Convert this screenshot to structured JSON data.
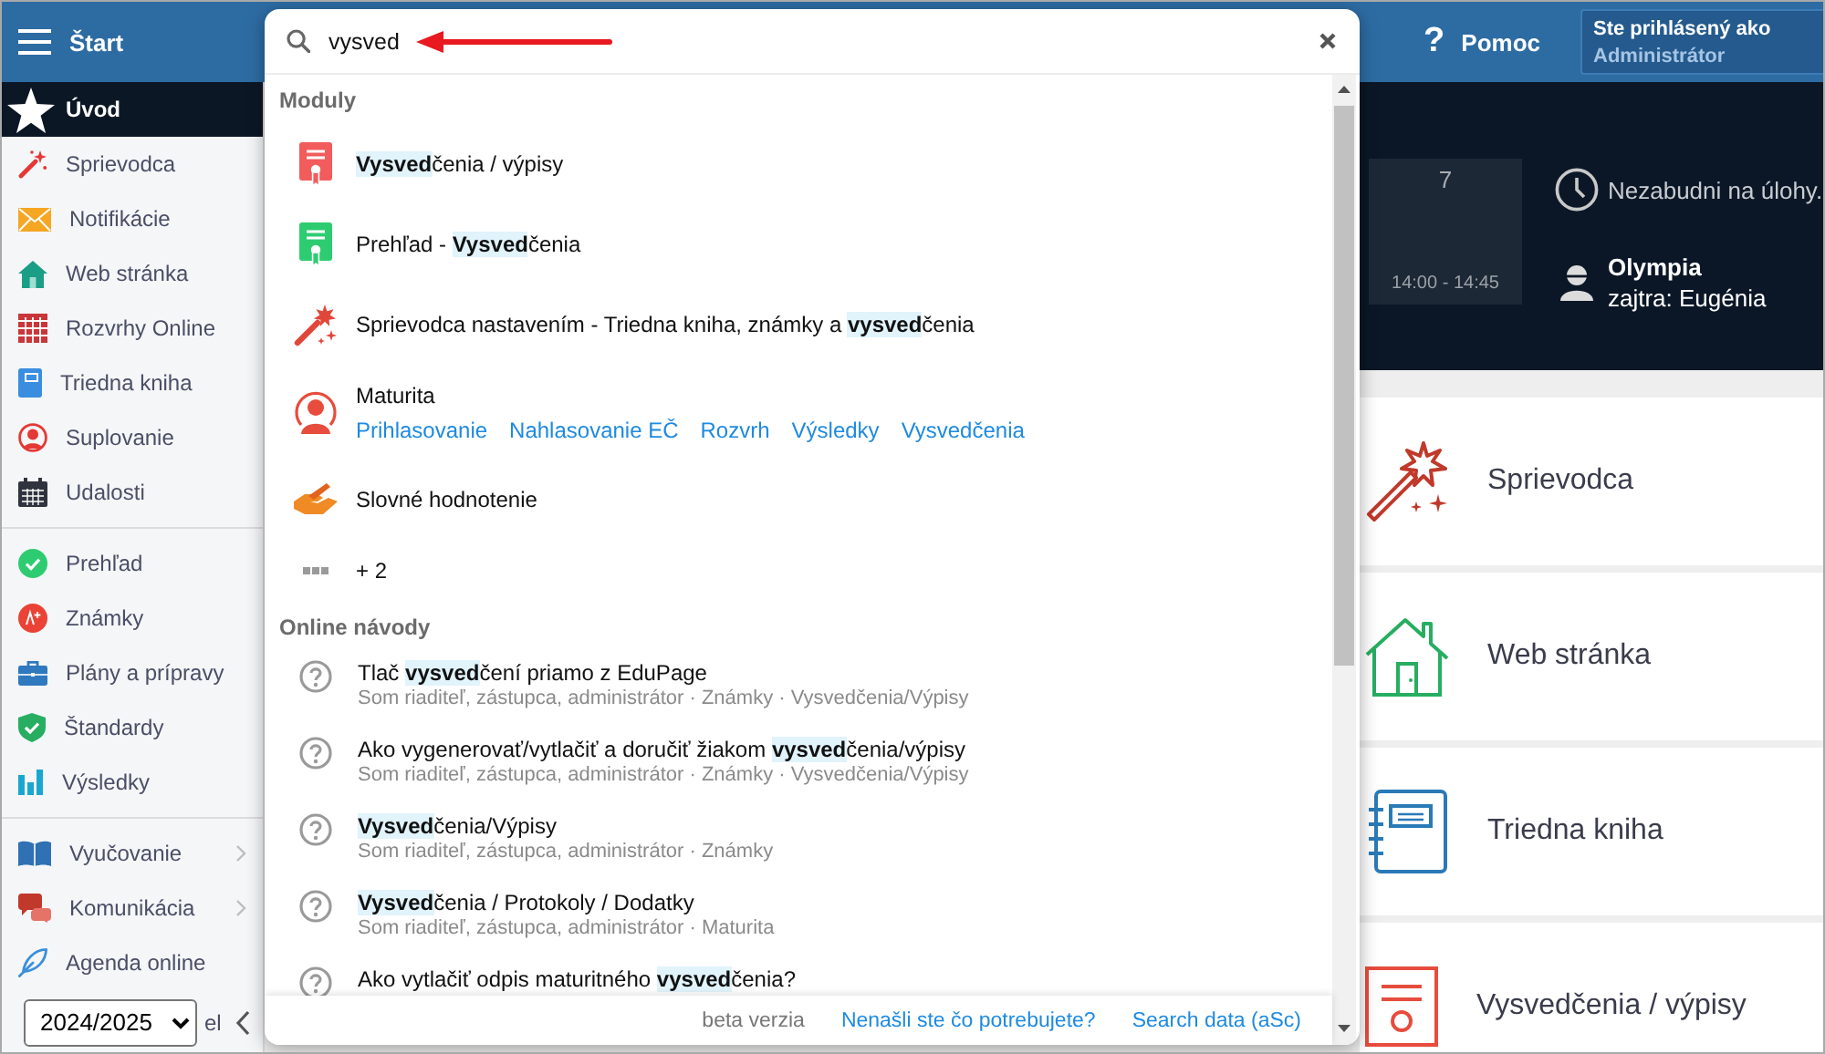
{
  "header": {
    "title": "Štart",
    "help": {
      "glyph": "?",
      "label": "Pomoc"
    },
    "login": {
      "caption": "Ste prihlásený ako",
      "user": "Administrátor"
    }
  },
  "sidebar": {
    "groups": [
      {
        "items": [
          {
            "label": "Úvod",
            "selected": true,
            "has_submenu": false
          },
          {
            "label": "Sprievodca",
            "selected": false,
            "has_submenu": false
          },
          {
            "label": "Notifikácie",
            "selected": false,
            "has_submenu": false
          },
          {
            "label": "Web stránka",
            "selected": false,
            "has_submenu": false
          },
          {
            "label": "Rozvrhy Online",
            "selected": false,
            "has_submenu": false
          },
          {
            "label": "Triedna kniha",
            "selected": false,
            "has_submenu": false
          },
          {
            "label": "Suplovanie",
            "selected": false,
            "has_submenu": false
          },
          {
            "label": "Udalosti",
            "selected": false,
            "has_submenu": false
          }
        ]
      },
      {
        "items": [
          {
            "label": "Prehľad",
            "selected": false,
            "has_submenu": false
          },
          {
            "label": "Známky",
            "selected": false,
            "has_submenu": false
          },
          {
            "label": "Plány a prípravy",
            "selected": false,
            "has_submenu": false
          },
          {
            "label": "Štandardy",
            "selected": false,
            "has_submenu": false
          },
          {
            "label": "Výsledky",
            "selected": false,
            "has_submenu": false
          }
        ]
      },
      {
        "items": [
          {
            "label": "Vyučovanie",
            "selected": false,
            "has_submenu": true
          },
          {
            "label": "Komunikácia",
            "selected": false,
            "has_submenu": true
          },
          {
            "label": "Agenda online",
            "selected": false,
            "has_submenu": false
          }
        ]
      }
    ],
    "year": "2024/2025",
    "partial_item": "el"
  },
  "dashboard": {
    "timetable": [
      {
        "period": "7",
        "time": "14:00 - 14:45"
      }
    ],
    "reminder": "Nezabudni na úlohy.",
    "nameday": {
      "name": "Olympia",
      "tomorrow": "zajtra: Eugénia"
    },
    "tiles": [
      "Sprievodca",
      "Web stránka",
      "Triedna kniha",
      "Vysvedčenia / výpisy"
    ]
  },
  "search": {
    "query": "vysved",
    "sections": [
      {
        "title": "Moduly",
        "items": [
          {
            "kind": "module",
            "title": "**Vysved**čenia / výpisy"
          },
          {
            "kind": "module",
            "title": "Prehľad - **Vysved**čenia"
          },
          {
            "kind": "module",
            "title": "Sprievodca nastavením - Triedna kniha, známky a **vysved**čenia"
          },
          {
            "kind": "module",
            "title": "Maturita",
            "links": [
              "Prihlasovanie",
              "Nahlasovanie EČ",
              "Rozvrh",
              "Výsledky",
              "Vysvedčenia"
            ]
          },
          {
            "kind": "module",
            "title": "Slovné hodnotenie"
          },
          {
            "kind": "more",
            "title": "+ 2"
          }
        ]
      },
      {
        "title": "Online návody",
        "items": [
          {
            "kind": "guide",
            "title": "Tlač **vysved**čení priamo z EduPage",
            "subtitle": "Som riaditeľ, zástupca, administrátor · Známky · Vysvedčenia/Výpisy"
          },
          {
            "kind": "guide",
            "title": "Ako vygenerovať/vytlačiť a doručiť žiakom **vysved**čenia/výpisy",
            "subtitle": "Som riaditeľ, zástupca, administrátor · Známky · Vysvedčenia/Výpisy"
          },
          {
            "kind": "guide",
            "title": "**Vysved**čenia/Výpisy",
            "subtitle": "Som riaditeľ, zástupca, administrátor · Známky"
          },
          {
            "kind": "guide",
            "title": "**Vysved**čenia / Protokoly / Dodatky",
            "subtitle": "Som riaditeľ, zástupca, administrátor · Maturita"
          },
          {
            "kind": "guide",
            "title": "Ako vytlačiť odpis maturitného **vysved**čenia?"
          }
        ]
      }
    ],
    "footer": {
      "note": "beta verzia",
      "links": [
        "Nenašli ste čo potrebujete?",
        "Search data (aSc)"
      ]
    }
  }
}
